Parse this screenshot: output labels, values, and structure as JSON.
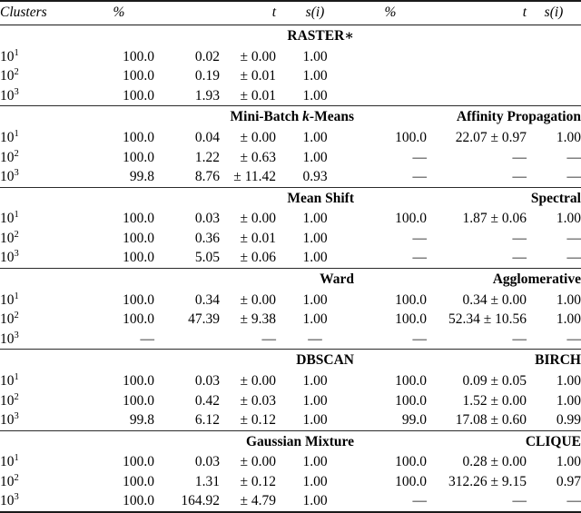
{
  "table": {
    "caption_present": false,
    "columns": {
      "clusters": "Clusters",
      "pct_left": "%",
      "t_left": "t",
      "si_left": "s(i)",
      "pct_right": "%",
      "t_right": "t",
      "si_right": "s(i)"
    },
    "symbols": {
      "plus_minus": "±",
      "dash": "—"
    },
    "row_labels": [
      {
        "base": "10",
        "exp": "1"
      },
      {
        "base": "10",
        "exp": "2"
      },
      {
        "base": "10",
        "exp": "3"
      }
    ],
    "sections": [
      {
        "left_title": "RASTER∗",
        "right_title": "",
        "rows": [
          {
            "label_base": "10",
            "label_exp": "1",
            "pct_l": "100.0",
            "mean_l": "0.02",
            "sd_l": "0.00",
            "si_l": "1.00",
            "pct_r": "",
            "ts_r": "",
            "si_r": ""
          },
          {
            "label_base": "10",
            "label_exp": "2",
            "pct_l": "100.0",
            "mean_l": "0.19",
            "sd_l": "0.01",
            "si_l": "1.00",
            "pct_r": "",
            "ts_r": "",
            "si_r": ""
          },
          {
            "label_base": "10",
            "label_exp": "3",
            "pct_l": "100.0",
            "mean_l": "1.93",
            "sd_l": "0.01",
            "si_l": "1.00",
            "pct_r": "",
            "ts_r": "",
            "si_r": ""
          }
        ]
      },
      {
        "left_title": "Mini-Batch k-Means",
        "left_title_html": "Mini-Batch <i>k</i>-Means",
        "right_title": "Affinity Propagation",
        "rows": [
          {
            "label_base": "10",
            "label_exp": "1",
            "pct_l": "100.0",
            "mean_l": "0.04",
            "sd_l": "0.00",
            "si_l": "1.00",
            "pct_r": "100.0",
            "ts_r": "22.07 ±  0.97",
            "si_r": "1.00"
          },
          {
            "label_base": "10",
            "label_exp": "2",
            "pct_l": "100.0",
            "mean_l": "1.22",
            "sd_l": "0.63",
            "si_l": "1.00",
            "pct_r": "—",
            "ts_r": "—",
            "si_r": "—"
          },
          {
            "label_base": "10",
            "label_exp": "3",
            "pct_l": "99.8",
            "mean_l": "8.76",
            "sd_l": "11.42",
            "si_l": "0.93",
            "pct_r": "—",
            "ts_r": "—",
            "si_r": "—"
          }
        ]
      },
      {
        "left_title": "Mean Shift",
        "right_title": "Spectral",
        "rows": [
          {
            "label_base": "10",
            "label_exp": "1",
            "pct_l": "100.0",
            "mean_l": "0.03",
            "sd_l": "0.00",
            "si_l": "1.00",
            "pct_r": "100.0",
            "ts_r": "1.87 ± 0.06",
            "si_r": "1.00"
          },
          {
            "label_base": "10",
            "label_exp": "2",
            "pct_l": "100.0",
            "mean_l": "0.36",
            "sd_l": "0.01",
            "si_l": "1.00",
            "pct_r": "—",
            "ts_r": "—",
            "si_r": "—"
          },
          {
            "label_base": "10",
            "label_exp": "3",
            "pct_l": "100.0",
            "mean_l": "5.05",
            "sd_l": "0.06",
            "si_l": "1.00",
            "pct_r": "—",
            "ts_r": "—",
            "si_r": "—"
          }
        ]
      },
      {
        "left_title": "Ward",
        "right_title": "Agglomerative",
        "rows": [
          {
            "label_base": "10",
            "label_exp": "1",
            "pct_l": "100.0",
            "mean_l": "0.34",
            "sd_l": "0.00",
            "si_l": "1.00",
            "pct_r": "100.0",
            "ts_r": "0.34 ± 0.00",
            "si_r": "1.00"
          },
          {
            "label_base": "10",
            "label_exp": "2",
            "pct_l": "100.0",
            "mean_l": "47.39",
            "sd_l": "9.38",
            "si_l": "1.00",
            "pct_r": "100.0",
            "ts_r": "52.34 ± 10.56",
            "si_r": "1.00"
          },
          {
            "label_base": "10",
            "label_exp": "3",
            "pct_l": "—",
            "mean_l": "",
            "sd_l": "—",
            "si_l": "—",
            "pct_r": "—",
            "ts_r": "—",
            "si_r": "—"
          }
        ]
      },
      {
        "left_title": "DBSCAN",
        "right_title": "BIRCH",
        "rows": [
          {
            "label_base": "10",
            "label_exp": "1",
            "pct_l": "100.0",
            "mean_l": "0.03",
            "sd_l": "0.00",
            "si_l": "1.00",
            "pct_r": "100.0",
            "ts_r": "0.09 ± 0.05",
            "si_r": "1.00"
          },
          {
            "label_base": "10",
            "label_exp": "2",
            "pct_l": "100.0",
            "mean_l": "0.42",
            "sd_l": "0.03",
            "si_l": "1.00",
            "pct_r": "100.0",
            "ts_r": "1.52 ± 0.00",
            "si_r": "1.00"
          },
          {
            "label_base": "10",
            "label_exp": "3",
            "pct_l": "99.8",
            "mean_l": "6.12",
            "sd_l": "0.12",
            "si_l": "1.00",
            "pct_r": "99.0",
            "ts_r": "17.08 ± 0.60",
            "si_r": "0.99"
          }
        ]
      },
      {
        "left_title": "Gaussian Mixture",
        "right_title": "CLIQUE",
        "rows": [
          {
            "label_base": "10",
            "label_exp": "1",
            "pct_l": "100.0",
            "mean_l": "0.03",
            "sd_l": "0.00",
            "si_l": "1.00",
            "pct_r": "100.0",
            "ts_r": "0.28 ± 0.00",
            "si_r": "1.00"
          },
          {
            "label_base": "10",
            "label_exp": "2",
            "pct_l": "100.0",
            "mean_l": "1.31",
            "sd_l": "0.12",
            "si_l": "1.00",
            "pct_r": "100.0",
            "ts_r": "312.26 ± 9.15",
            "si_r": "0.97"
          },
          {
            "label_base": "10",
            "label_exp": "3",
            "pct_l": "100.0",
            "mean_l": "164.92",
            "sd_l": "4.79",
            "si_l": "1.00",
            "pct_r": "—",
            "ts_r": "—",
            "si_r": "—"
          }
        ]
      }
    ]
  }
}
